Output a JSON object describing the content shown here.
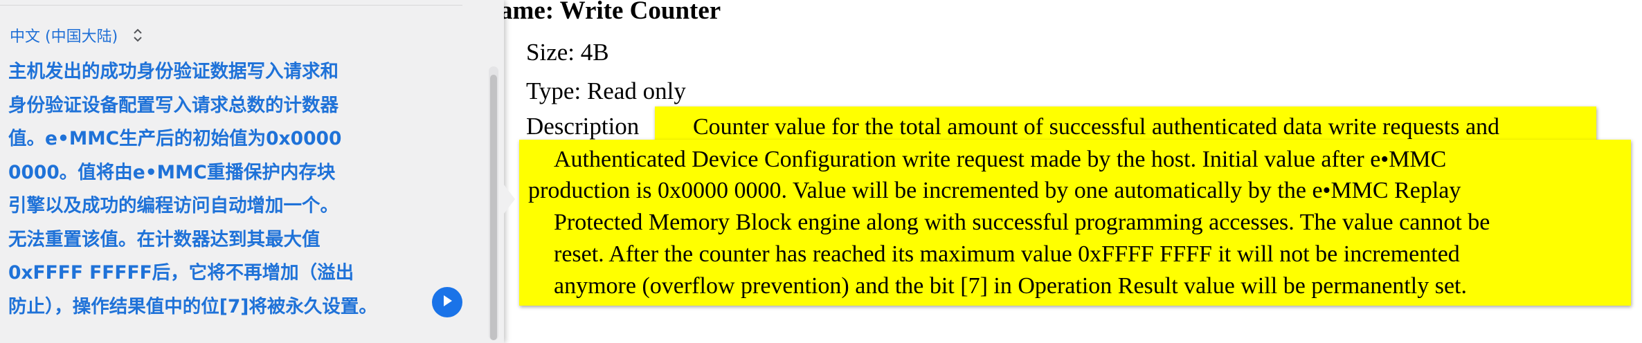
{
  "document": {
    "title": "ame: Write Counter",
    "size_line": "Size: 4B",
    "type_line": "Type: Read only",
    "description_label": "Description"
  },
  "highlight": {
    "lines": [
      "Counter value for the total amount of successful authenticated data write requests and",
      "Authenticated Device Configuration write request made by the host. Initial value after e•MMC",
      "production is 0x0000 0000. Value will be incremented by one automatically by the e•MMC Replay",
      "Protected Memory Block engine along with successful programming accesses. The value cannot be",
      "reset. After the counter has reached its maximum value 0xFFFF FFFF it will not be incremented",
      "anymore (overflow prevention) and the bit [7] in Operation Result value will be permanently set."
    ],
    "color": "#ffff00"
  },
  "translation_panel": {
    "language": "中文 (中国大陆)",
    "language_icon": "chevron-up-down-icon",
    "lines": [
      "主机发出的成功身份验证数据写入请求和",
      "身份验证设备配置写入请求总数的计数器",
      "值。e•MMC生产后的初始值为0x0000",
      "0000。值将由e•MMC重播保护内存块",
      "引擎以及成功的编程访问自动增加一个。",
      "无法重置该值。在计数器达到其最大值",
      "0xFFFF FFFFF后，它将不再增加（溢出",
      "防止），操作结果值中的位[7]将被永久设置。"
    ],
    "play_icon": "play-icon",
    "accent_color": "#1f72d8"
  }
}
